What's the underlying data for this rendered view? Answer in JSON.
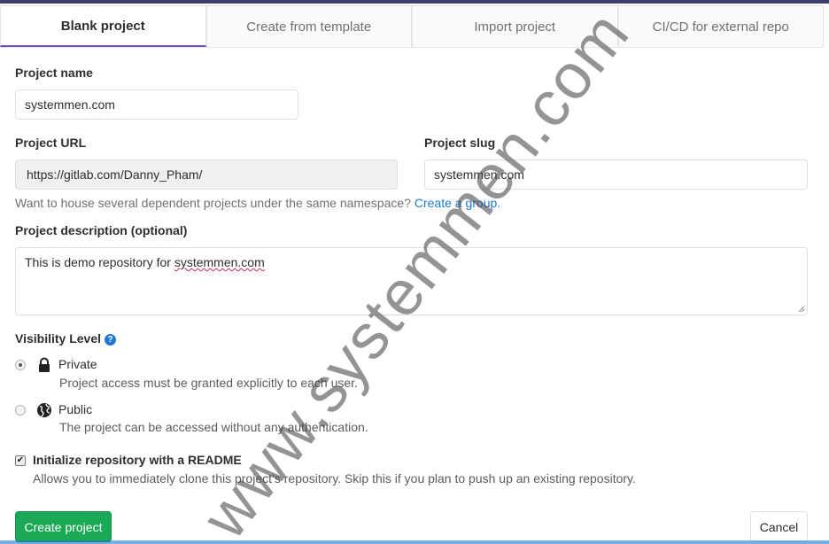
{
  "tabs": [
    {
      "label": "Blank project",
      "active": true
    },
    {
      "label": "Create from template",
      "active": false
    },
    {
      "label": "Import project",
      "active": false
    },
    {
      "label": "CI/CD for external repo",
      "active": false
    }
  ],
  "form": {
    "project_name_label": "Project name",
    "project_name_value": "systemmen.com",
    "project_url_label": "Project URL",
    "project_url_value": "https://gitlab.com/Danny_Pham/",
    "project_slug_label": "Project slug",
    "project_slug_value": "systemmen.com",
    "namespace_help": "Want to house several dependent projects under the same namespace?",
    "create_group_link": "Create a group.",
    "description_label": "Project description (optional)",
    "description_prefix": "This is demo repository for ",
    "description_misspelled": "systemmen.com",
    "visibility_label": "Visibility Level",
    "visibility_help_icon": "question-circle-icon",
    "visibility_options": [
      {
        "title": "Private",
        "description": "Project access must be granted explicitly to each user.",
        "icon": "lock-icon",
        "selected": true
      },
      {
        "title": "Public",
        "description": "The project can be accessed without any authentication.",
        "icon": "globe-icon",
        "selected": false
      }
    ],
    "readme_label": "Initialize repository with a README",
    "readme_checked": true,
    "readme_description": "Allows you to immediately clone this project’s repository. Skip this if you plan to push up an existing repository."
  },
  "actions": {
    "create_label": "Create project",
    "cancel_label": "Cancel"
  },
  "watermark": "www.systemmen.com",
  "colors": {
    "primary_button": "#1aaa55",
    "link": "#1f78d1",
    "active_tab_border": "#6b4fbb"
  }
}
